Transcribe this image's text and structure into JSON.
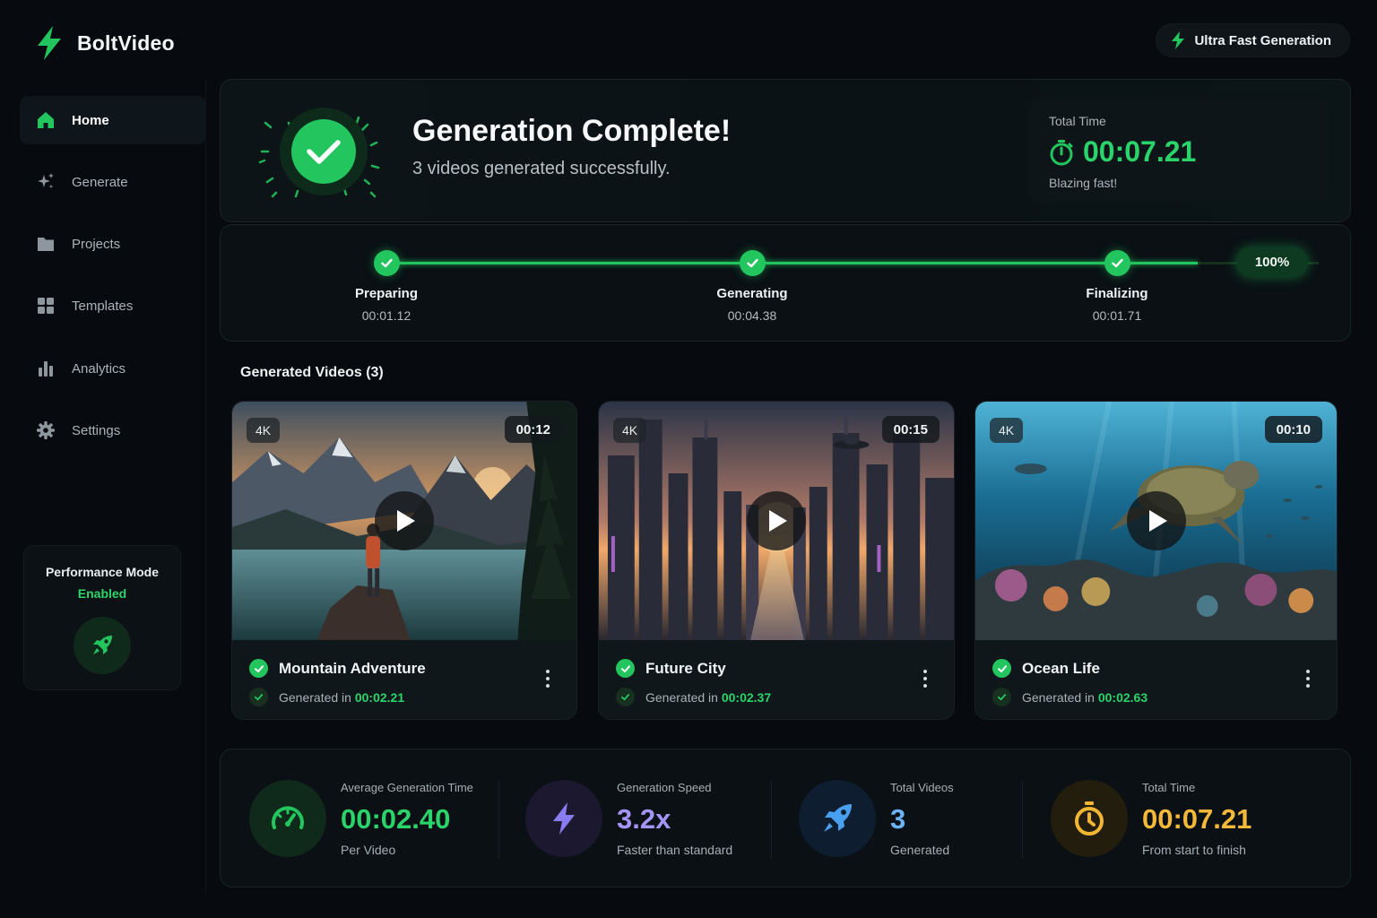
{
  "app": {
    "name": "BoltVideo",
    "badge": "Ultra Fast Generation"
  },
  "colors": {
    "accent": "#22c55e",
    "purple": "#a78bfa",
    "blue": "#60a5fa",
    "amber": "#fbbf24"
  },
  "sidebar": {
    "items": [
      {
        "label": "Home",
        "icon": "home-icon",
        "active": true
      },
      {
        "label": "Generate",
        "icon": "sparkle-icon"
      },
      {
        "label": "Projects",
        "icon": "folder-icon"
      },
      {
        "label": "Templates",
        "icon": "grid-icon"
      },
      {
        "label": "Analytics",
        "icon": "bar-chart-icon"
      },
      {
        "label": "Settings",
        "icon": "gear-icon"
      }
    ],
    "performance": {
      "title": "Performance Mode",
      "status": "Enabled",
      "icon": "rocket-icon"
    }
  },
  "hero": {
    "title": "Generation Complete!",
    "subtitle": "3 videos generated successfully.",
    "total_label": "Total Time",
    "total_value": "00:07.21",
    "total_note": "Blazing fast!"
  },
  "progress": {
    "percent": "100%",
    "percent_value": 1.0,
    "steps": [
      {
        "name": "Preparing",
        "time": "00:01.12"
      },
      {
        "name": "Generating",
        "time": "00:04.38"
      },
      {
        "name": "Finalizing",
        "time": "00:01.71"
      }
    ]
  },
  "videos": {
    "title": "Generated Videos (3)",
    "items": [
      {
        "name": "Mountain Adventure",
        "resolution": "4K",
        "duration": "00:12",
        "generated_label": "Generated in",
        "generated_time": "00:02.21"
      },
      {
        "name": "Future City",
        "resolution": "4K",
        "duration": "00:15",
        "generated_label": "Generated in",
        "generated_time": "00:02.37"
      },
      {
        "name": "Ocean Life",
        "resolution": "4K",
        "duration": "00:10",
        "generated_label": "Generated in",
        "generated_time": "00:02.63"
      }
    ]
  },
  "stats": [
    {
      "label": "Average Generation Time",
      "value": "00:02.40",
      "note": "Per Video",
      "icon": "speedometer-icon"
    },
    {
      "label": "Generation Speed",
      "value": "3.2x",
      "note": "Faster than standard",
      "icon": "bolt-icon"
    },
    {
      "label": "Total Videos",
      "value": "3",
      "note": "Generated",
      "icon": "rocket-icon"
    },
    {
      "label": "Total Time",
      "value": "00:07.21",
      "note": "From start to finish",
      "icon": "stopwatch-icon"
    }
  ]
}
